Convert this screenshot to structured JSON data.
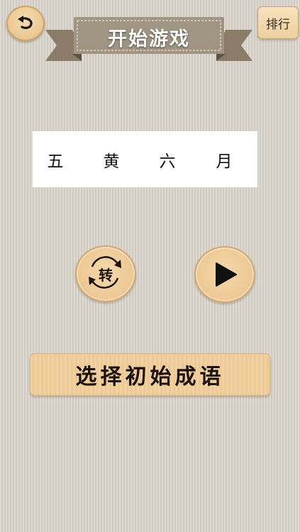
{
  "header": {
    "back_icon": "back-arrow-icon",
    "title": "开始游戏",
    "rank_label": "排行"
  },
  "idiom": {
    "chars": [
      "五",
      "黄",
      "六",
      "月"
    ]
  },
  "controls": {
    "rotate_label": "转",
    "rotate_icon": "rotate-arrows-icon",
    "play_icon": "play-icon",
    "choose_label": "选择初始成语"
  },
  "colors": {
    "background": "#d8d3c8",
    "button_fill": "#f1d1a1",
    "banner_fill": "#9a8c79"
  }
}
